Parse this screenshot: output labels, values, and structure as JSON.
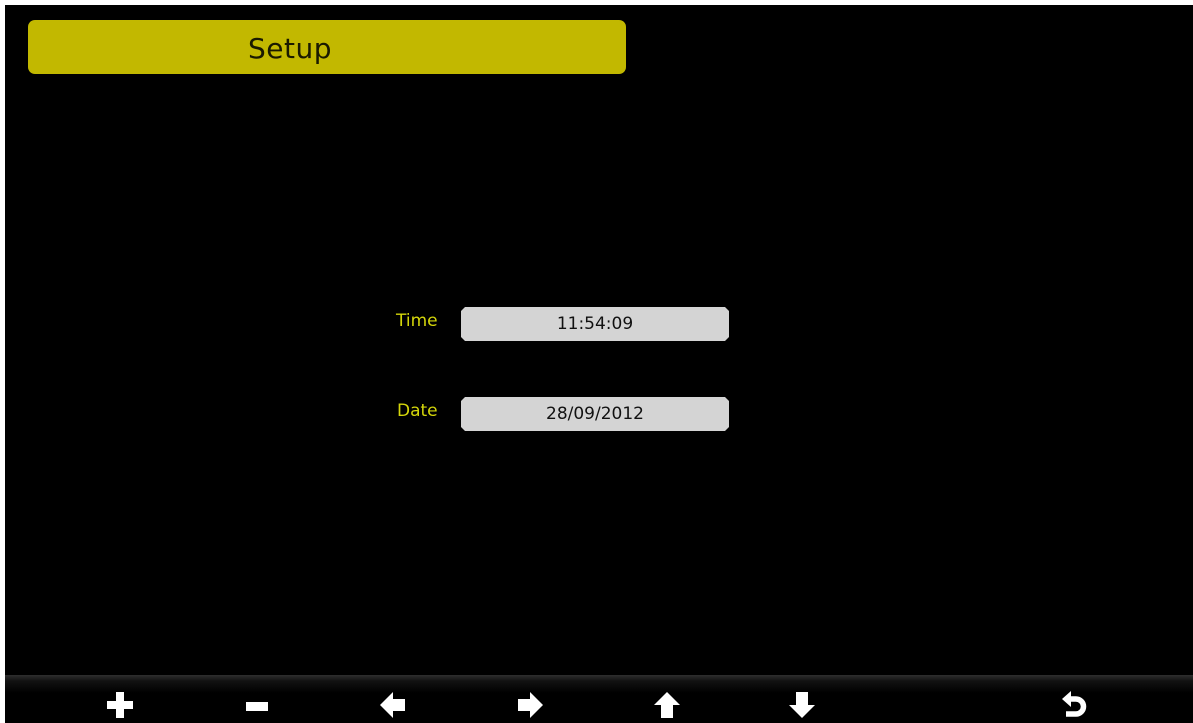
{
  "header": {
    "title": "Setup"
  },
  "fields": {
    "time": {
      "label": "Time",
      "value": "11:54:09"
    },
    "date": {
      "label": "Date",
      "value": "28/09/2012"
    }
  },
  "toolbar": {
    "buttons": [
      {
        "icon": "plus-icon"
      },
      {
        "icon": "minus-icon"
      },
      {
        "icon": "arrow-left-icon"
      },
      {
        "icon": "arrow-right-icon"
      },
      {
        "icon": "arrow-up-icon"
      },
      {
        "icon": "arrow-down-icon"
      },
      {
        "icon": "return-icon"
      }
    ]
  },
  "colors": {
    "background": "#000000",
    "title_bar": "#c2b800",
    "label": "#d4d60a",
    "field_box": "#d4d4d4",
    "icon": "#ffffff"
  }
}
